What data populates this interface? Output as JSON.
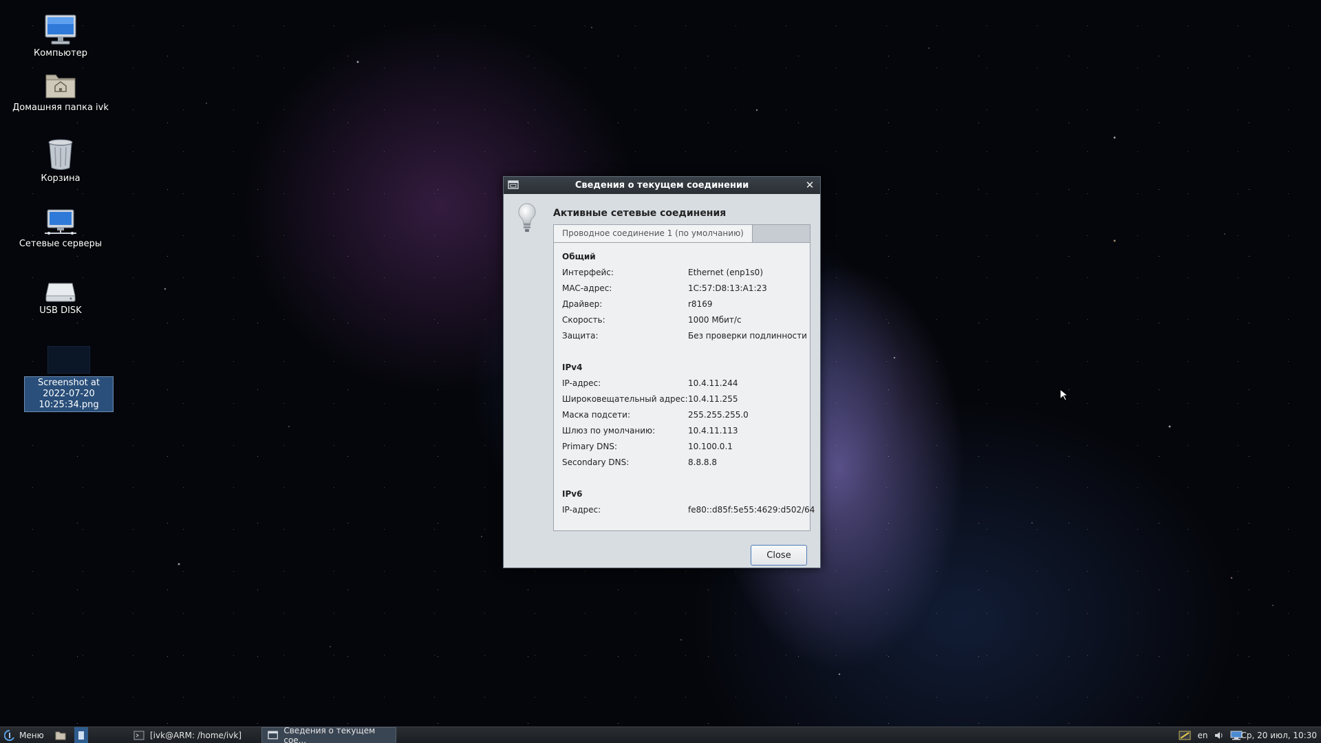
{
  "desktop": {
    "icons": [
      {
        "label": "Компьютер",
        "icon": "computer-icon"
      },
      {
        "label": "Домашняя папка ivk",
        "icon": "home-folder-icon"
      },
      {
        "label": "Корзина",
        "icon": "trash-icon"
      },
      {
        "label": "Сетевые серверы",
        "icon": "network-servers-icon"
      },
      {
        "label": "USB DISK",
        "icon": "usb-disk-icon"
      },
      {
        "label": "Screenshot at 2022-07-20 10:25:34.png",
        "icon": "image-file-icon"
      }
    ]
  },
  "dialog": {
    "title": "Сведения о текущем соединении",
    "heading": "Активные сетевые соединения",
    "tab_label": "Проводное соединение 1 (по умолчанию)",
    "sections": {
      "general": {
        "title": "Общий",
        "rows": [
          {
            "key": "Интерфейс:",
            "value": "Ethernet (enp1s0)"
          },
          {
            "key": "MAC-адрес:",
            "value": "1C:57:D8:13:A1:23"
          },
          {
            "key": "Драйвер:",
            "value": "r8169"
          },
          {
            "key": "Скорость:",
            "value": "1000 Мбит/с"
          },
          {
            "key": "Защита:",
            "value": "Без проверки подлинности"
          }
        ]
      },
      "ipv4": {
        "title": "IPv4",
        "rows": [
          {
            "key": "IP-адрес:",
            "value": "10.4.11.244"
          },
          {
            "key": "Широковещательный адрес:",
            "value": "10.4.11.255"
          },
          {
            "key": "Маска подсети:",
            "value": "255.255.255.0"
          },
          {
            "key": "Шлюз по умолчанию:",
            "value": "10.4.11.113"
          },
          {
            "key": "Primary DNS:",
            "value": "10.100.0.1"
          },
          {
            "key": "Secondary DNS:",
            "value": "8.8.8.8"
          }
        ]
      },
      "ipv6": {
        "title": "IPv6",
        "rows": [
          {
            "key": "IP-адрес:",
            "value": "fe80::d85f:5e55:4629:d502/64"
          }
        ]
      }
    },
    "close_button": "Close"
  },
  "taskbar": {
    "menu_label": "Меню",
    "tasks": [
      {
        "label": "[ivk@ARM: /home/ivk]",
        "icon": "terminal-icon"
      },
      {
        "label": "Сведения о текущем сое...",
        "icon": "window-icon"
      }
    ],
    "keyboard_layout": "en",
    "clock": "Ср, 20 июл, 10:30"
  }
}
